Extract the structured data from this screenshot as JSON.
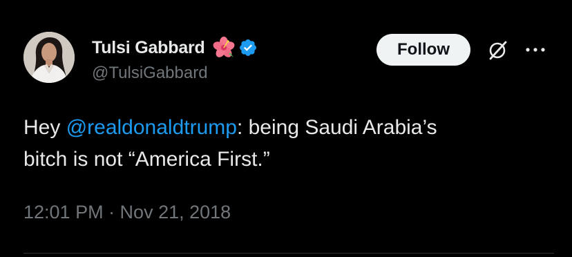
{
  "author": {
    "display_name": "Tulsi Gabbard",
    "handle": "@TulsiGabbard",
    "name_emoji_icon": "hibiscus-flower-icon",
    "badge_icon": "verified-badge-icon",
    "avatar_icon": "profile-photo"
  },
  "actions": {
    "follow_label": "Follow",
    "grok_icon": "grok-slash-icon",
    "more_icon": "more-dots-icon"
  },
  "tweet": {
    "line1_before": "Hey ",
    "mention": "@realdonaldtrump",
    "line1_after": ": being Saudi Arabia’s",
    "line2": "bitch is not “America First.”"
  },
  "meta": {
    "timestamp": "12:01 PM · Nov 21, 2018"
  },
  "colors": {
    "background": "#000000",
    "text_primary": "#e7e9ea",
    "text_secondary": "#71767b",
    "link": "#1d9bf0",
    "verified": "#1d9bf0",
    "follow_bg": "#eff3f4",
    "divider": "#2f3336"
  }
}
